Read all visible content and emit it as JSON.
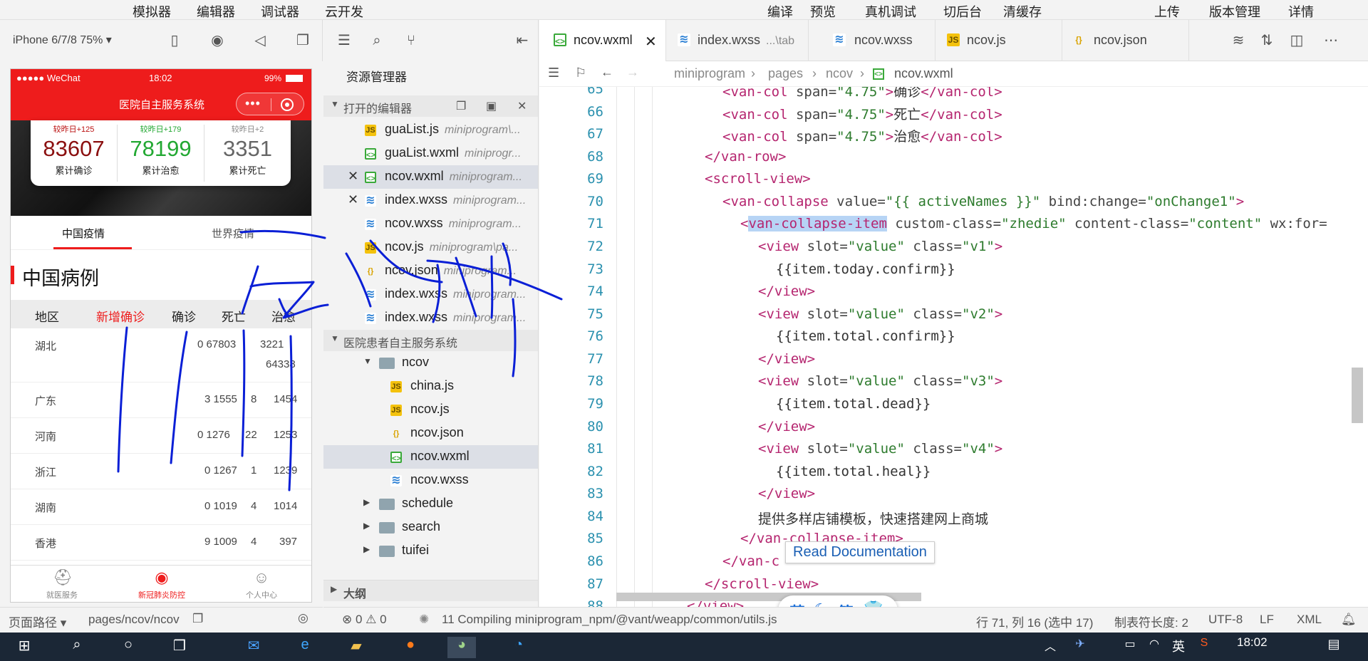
{
  "menubar": {
    "items_left": [
      "模拟器",
      "编辑器",
      "调试器",
      "云开发"
    ],
    "items_right": [
      "编译",
      "预览",
      "真机调试",
      "切后台",
      "清缓存",
      "上传",
      "版本管理",
      "详情"
    ]
  },
  "simulator": {
    "device": "iPhone 6/7/8 75% ▾",
    "status": {
      "carrier": "●●●●● WeChat",
      "time": "18:02",
      "battery": "99%"
    },
    "nav_title": "医院自主服务系统",
    "stats": [
      {
        "delta": "较昨日+125",
        "value": "83607",
        "label": "累计确诊",
        "color": "#8b1010"
      },
      {
        "delta": "较昨日+179",
        "value": "78199",
        "label": "累计治愈",
        "color": "#22a832"
      },
      {
        "delta": "较昨日+2",
        "value": "3351",
        "label": "累计死亡",
        "color": "#666666"
      }
    ],
    "tabs": [
      "中国疫情",
      "世界疫情"
    ],
    "section_title": "中国病例",
    "table_headers": [
      "地区",
      "新增确诊",
      "确诊",
      "死亡",
      "治愈"
    ],
    "rows": [
      {
        "region": "湖北",
        "a": "0 67803",
        "b": "3221",
        "c": "64338"
      },
      {
        "region": "广东",
        "a": "3 1555",
        "b": "8",
        "c": "1454"
      },
      {
        "region": "河南",
        "a": "0 1276",
        "b": "22",
        "c": "1253"
      },
      {
        "region": "浙江",
        "a": "0 1267",
        "b": "1",
        "c": "1239"
      },
      {
        "region": "湖南",
        "a": "0 1019",
        "b": "4",
        "c": "1014"
      },
      {
        "region": "香港",
        "a": "9 1009",
        "b": "4",
        "c": "397"
      }
    ],
    "tabbar": [
      "就医服务",
      "新冠肺炎防控",
      "个人中心"
    ],
    "path_label": "页面路径 ▾",
    "path": "pages/ncov/ncov"
  },
  "explorer": {
    "title": "资源管理器",
    "open_editors": "打开的编辑器",
    "open_files": [
      {
        "name": "guaList.js",
        "path": "miniprogram\\...",
        "type": "js"
      },
      {
        "name": "guaList.wxml",
        "path": "miniprogr...",
        "type": "wxml"
      },
      {
        "name": "ncov.wxml",
        "path": "miniprogram...",
        "type": "wxml"
      },
      {
        "name": "index.wxss",
        "path": "miniprogram...",
        "type": "wxss"
      },
      {
        "name": "ncov.wxss",
        "path": "miniprogram...",
        "type": "wxss"
      },
      {
        "name": "ncov.js",
        "path": "miniprogram\\pa...",
        "type": "js"
      },
      {
        "name": "ncov.json",
        "path": "miniprogram...",
        "type": "json"
      },
      {
        "name": "index.wxss",
        "path": "miniprogram...",
        "type": "wxss"
      },
      {
        "name": "index.wxss",
        "path": "miniprogram...",
        "type": "wxss"
      }
    ],
    "project": "医院患者自主服务系统",
    "folder": "ncov",
    "folder_files": [
      "china.js",
      "ncov.js",
      "ncov.json",
      "ncov.wxml",
      "ncov.wxss"
    ],
    "other_folders": [
      "schedule",
      "search",
      "tuifei"
    ],
    "outline": "大纲"
  },
  "editor": {
    "tabs": [
      {
        "name": "ncov.wxml",
        "extra": "",
        "type": "wxml"
      },
      {
        "name": "index.wxss",
        "extra": "...\\tab",
        "type": "wxss"
      },
      {
        "name": "ncov.wxss",
        "extra": "",
        "type": "wxss"
      },
      {
        "name": "ncov.js",
        "extra": "",
        "type": "js"
      },
      {
        "name": "ncov.json",
        "extra": "",
        "type": "json"
      }
    ],
    "breadcrumb": [
      "miniprogram",
      "pages",
      "ncov",
      "ncov.wxml"
    ],
    "tooltip": "Read Documentation",
    "ime": [
      "英",
      "简"
    ]
  },
  "statusbar": {
    "problems": "⊗ 0 ⚠ 0",
    "compiling": "11 Compiling miniprogram_npm/@vant/weapp/common/utils.js",
    "cursor": "行 71, 列 16 (选中 17)",
    "tab_size": "制表符长度: 2",
    "encoding": "UTF-8",
    "eol": "LF",
    "lang": "XML"
  },
  "taskbar": {
    "time": "18:02",
    "ime": "英"
  },
  "code": {
    "line_numbers": [
      "65",
      "66",
      "67",
      "68",
      "69",
      "70",
      "71",
      "72",
      "73",
      "74",
      "75",
      "76",
      "77",
      "78",
      "79",
      "80",
      "81",
      "82",
      "83",
      "84",
      "85",
      "86",
      "87",
      "88"
    ],
    "l65": {
      "t1": "<van-col",
      "a1": " span=",
      "s1": "\"4.75\"",
      "t2": ">",
      "x": "确诊",
      "t3": "</van-col>"
    },
    "l66": {
      "t1": "<van-col",
      "a1": " span=",
      "s1": "\"4.75\"",
      "t2": ">",
      "x": "死亡",
      "t3": "</van-col>"
    },
    "l67": {
      "t1": "<van-col",
      "a1": " span=",
      "s1": "\"4.75\"",
      "t2": ">",
      "x": "治愈",
      "t3": "</van-col>"
    },
    "l68": "</van-row>",
    "l69": "<scroll-view>",
    "l70": {
      "t1": "<van-collapse",
      "a1": " value=",
      "s1": "\"{{ activeNames }}\"",
      "a2": " bind:change=",
      "s2": "\"onChange1\"",
      "t2": ">"
    },
    "l71": {
      "t0": "<",
      "hl": "van-collapse-item",
      "a1": " custom-class=",
      "s1": "\"zhedie\"",
      "a2": " content-class=",
      "s2": "\"content\"",
      "a3": " wx:for="
    },
    "l72": {
      "t1": "<view",
      "a1": " slot=",
      "s1": "\"value\"",
      "a2": " class=",
      "s2": "\"v1\"",
      "t2": ">"
    },
    "l73": "{{item.today.confirm}}",
    "l74": "</view>",
    "l75": {
      "t1": "<view",
      "a1": " slot=",
      "s1": "\"value\"",
      "a2": " class=",
      "s2": "\"v2\"",
      "t2": ">"
    },
    "l76": "{{item.total.confirm}}",
    "l77": "</view>",
    "l78": {
      "t1": "<view",
      "a1": " slot=",
      "s1": "\"value\"",
      "a2": " class=",
      "s2": "\"v3\"",
      "t2": ">"
    },
    "l79": "{{item.total.dead}}",
    "l80": "</view>",
    "l81": {
      "t1": "<view",
      "a1": " slot=",
      "s1": "\"value\"",
      "a2": " class=",
      "s2": "\"v4\"",
      "t2": ">"
    },
    "l82": "{{item.total.heal}}",
    "l83": "</view>",
    "l84": "提供多样店铺模板，快速搭建网上商城",
    "l85": "</van-collapse-item>",
    "l86": "</van-c",
    "l87": "</scroll-view>",
    "l88": "</view>"
  },
  "colors": {
    "brand_red": "#ee1c1c",
    "tag": "#b5256f",
    "string": "#2d7b2d",
    "line_number": "#2b91af",
    "annotation_ink": "#0a1fd6"
  }
}
